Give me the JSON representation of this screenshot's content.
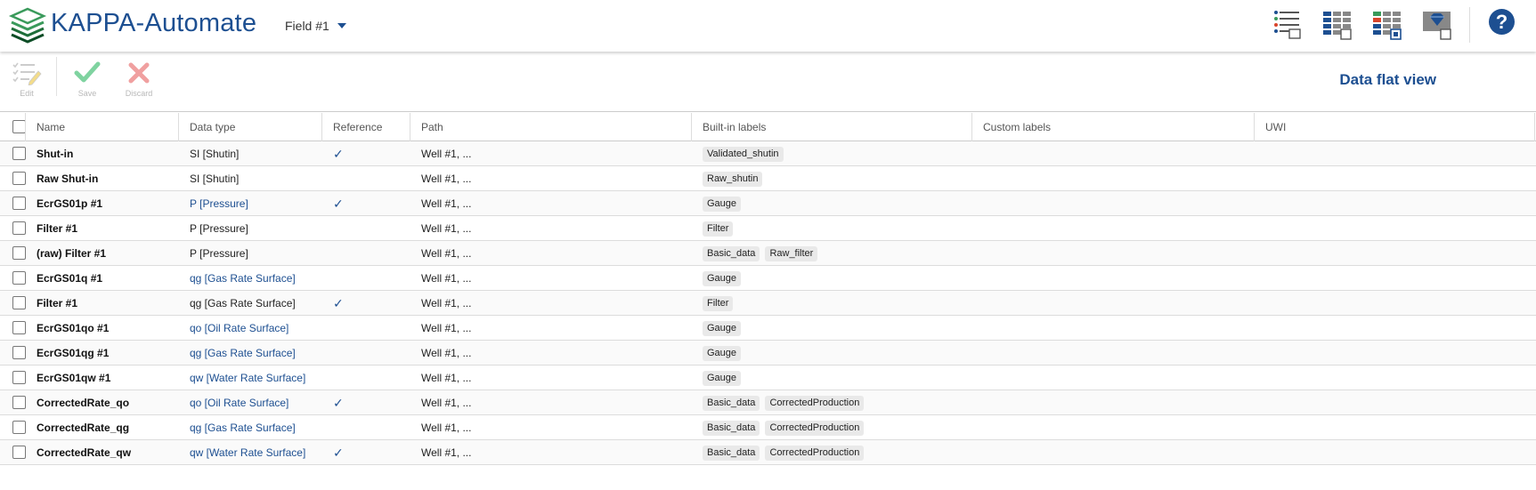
{
  "header": {
    "app_title": "KAPPA-Automate",
    "field_selector": "Field #1",
    "icons": [
      "list-tree-icon",
      "grid-view-icon",
      "colored-grid-view-icon",
      "data-gem-view-icon",
      "help-icon"
    ],
    "help_label": "?"
  },
  "toolbar": {
    "edit_label": "Edit",
    "save_label": "Save",
    "discard_label": "Discard",
    "view_title": "Data flat view"
  },
  "table": {
    "columns": {
      "name": "Name",
      "data_type": "Data type",
      "reference": "Reference",
      "path": "Path",
      "builtin_labels": "Built-in labels",
      "custom_labels": "Custom labels",
      "uwi": "UWI"
    },
    "rows": [
      {
        "name": "Shut-in",
        "type": "SI [Shutin]",
        "type_link": false,
        "reference": "✓",
        "path": "Well #1, ...",
        "labels": [
          "Validated_shutin"
        ]
      },
      {
        "name": "Raw Shut-in",
        "type": "SI [Shutin]",
        "type_link": false,
        "reference": "",
        "path": "Well #1, ...",
        "labels": [
          "Raw_shutin"
        ]
      },
      {
        "name": "EcrGS01p #1",
        "type": "P [Pressure]",
        "type_link": true,
        "reference": "✓",
        "path": "Well #1, ...",
        "labels": [
          "Gauge"
        ]
      },
      {
        "name": "Filter #1",
        "type": "P [Pressure]",
        "type_link": false,
        "reference": "",
        "path": "Well #1, ...",
        "labels": [
          "Filter"
        ]
      },
      {
        "name": "(raw) Filter #1",
        "type": "P [Pressure]",
        "type_link": false,
        "reference": "",
        "path": "Well #1, ...",
        "labels": [
          "Basic_data",
          "Raw_filter"
        ]
      },
      {
        "name": "EcrGS01q #1",
        "type": "qg [Gas Rate Surface]",
        "type_link": true,
        "reference": "",
        "path": "Well #1, ...",
        "labels": [
          "Gauge"
        ]
      },
      {
        "name": "Filter #1",
        "type": "qg [Gas Rate Surface]",
        "type_link": false,
        "reference": "✓",
        "path": "Well #1, ...",
        "labels": [
          "Filter"
        ]
      },
      {
        "name": "EcrGS01qo #1",
        "type": "qo [Oil Rate Surface]",
        "type_link": true,
        "reference": "",
        "path": "Well #1, ...",
        "labels": [
          "Gauge"
        ]
      },
      {
        "name": "EcrGS01qg #1",
        "type": "qg [Gas Rate Surface]",
        "type_link": true,
        "reference": "",
        "path": "Well #1, ...",
        "labels": [
          "Gauge"
        ]
      },
      {
        "name": "EcrGS01qw #1",
        "type": "qw [Water Rate Surface]",
        "type_link": true,
        "reference": "",
        "path": "Well #1, ...",
        "labels": [
          "Gauge"
        ]
      },
      {
        "name": "CorrectedRate_qo",
        "type": "qo [Oil Rate Surface]",
        "type_link": true,
        "reference": "✓",
        "path": "Well #1, ...",
        "labels": [
          "Basic_data",
          "CorrectedProduction"
        ]
      },
      {
        "name": "CorrectedRate_qg",
        "type": "qg [Gas Rate Surface]",
        "type_link": true,
        "reference": "",
        "path": "Well #1, ...",
        "labels": [
          "Basic_data",
          "CorrectedProduction"
        ]
      },
      {
        "name": "CorrectedRate_qw",
        "type": "qw [Water Rate Surface]",
        "type_link": true,
        "reference": "✓",
        "path": "Well #1, ...",
        "labels": [
          "Basic_data",
          "CorrectedProduction"
        ]
      }
    ]
  },
  "colors": {
    "brand_blue": "#1d4f91",
    "logo_green": "#3a9a5b",
    "save_green": "#7fd3a0",
    "discard_red": "#f0a0a0"
  }
}
